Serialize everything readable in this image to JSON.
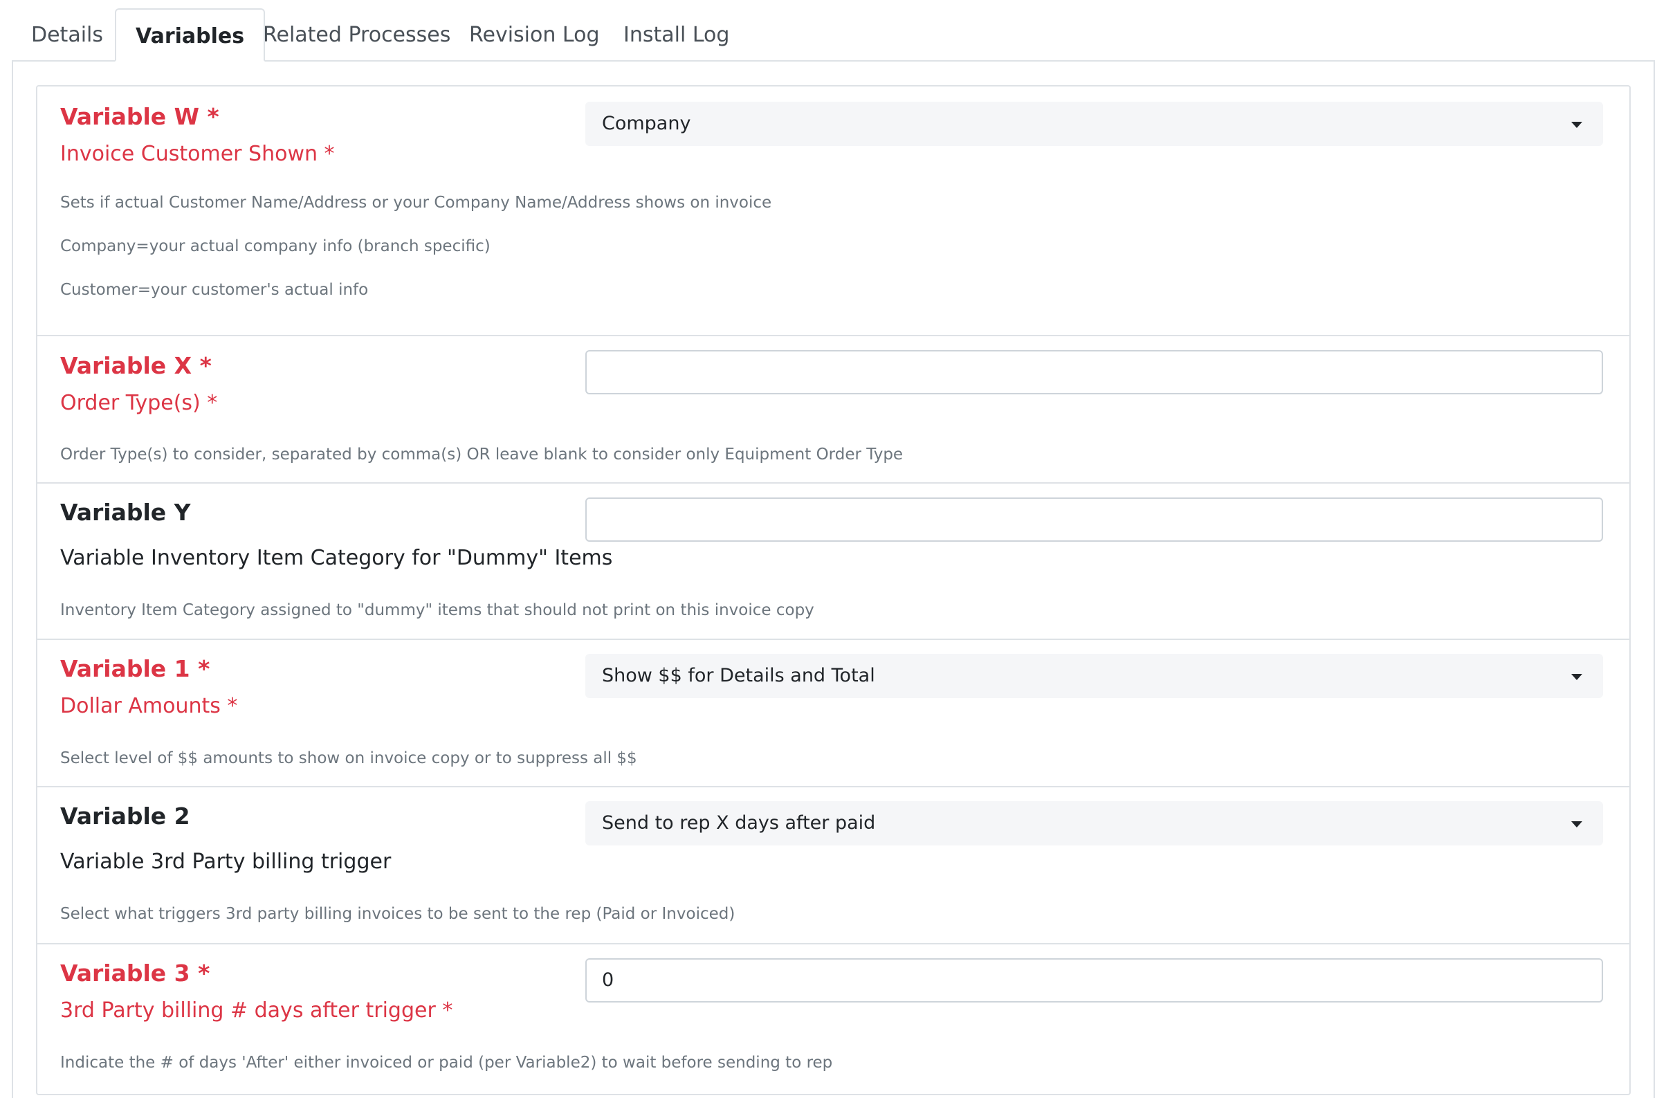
{
  "tabs": [
    {
      "label": "Details"
    },
    {
      "label": "Variables"
    },
    {
      "label": "Related Processes"
    },
    {
      "label": "Revision Log"
    },
    {
      "label": "Install Log"
    }
  ],
  "active_tab": "Variables",
  "variables": [
    {
      "title": "Variable W *",
      "label": "Invoice Customer Shown *",
      "required": true,
      "control": "select",
      "value": "Company",
      "help": [
        "Sets if actual Customer Name/Address or your Company Name/Address shows on invoice",
        "Company=your actual company info (branch specific)",
        "Customer=your customer's actual info"
      ]
    },
    {
      "title": "Variable X *",
      "label": "Order Type(s) *",
      "required": true,
      "control": "text",
      "value": "",
      "help": [
        "Order Type(s) to consider, separated by comma(s) OR leave blank to consider only Equipment Order Type"
      ]
    },
    {
      "title": "Variable Y",
      "label": "Variable Inventory Item Category for \"Dummy\" Items",
      "required": false,
      "control": "text",
      "value": "",
      "help": [
        "Inventory Item Category assigned to \"dummy\" items that should not print on this invoice copy"
      ]
    },
    {
      "title": "Variable 1 *",
      "label": "Dollar Amounts *",
      "required": true,
      "control": "select",
      "value": "Show $$ for Details and Total",
      "help": [
        "Select level of $$ amounts to show on invoice copy or to suppress all $$"
      ]
    },
    {
      "title": "Variable 2",
      "label": "Variable 3rd Party billing trigger",
      "required": false,
      "control": "select",
      "value": "Send to rep X days after paid",
      "help": [
        "Select what triggers 3rd party billing invoices to be sent to the rep (Paid or Invoiced)"
      ]
    },
    {
      "title": "Variable 3 *",
      "label": "3rd Party billing # days after trigger *",
      "required": true,
      "control": "text",
      "value": "0",
      "help": [
        "Indicate the # of days 'After' either invoiced or paid (per Variable2) to wait before sending to rep"
      ]
    }
  ],
  "colors": {
    "required": "#dc3545",
    "help_text": "#6c757d",
    "border": "#dee2e6",
    "select_bg": "#f5f6f8"
  },
  "icons": {
    "select_caret": "caret-down-icon"
  }
}
